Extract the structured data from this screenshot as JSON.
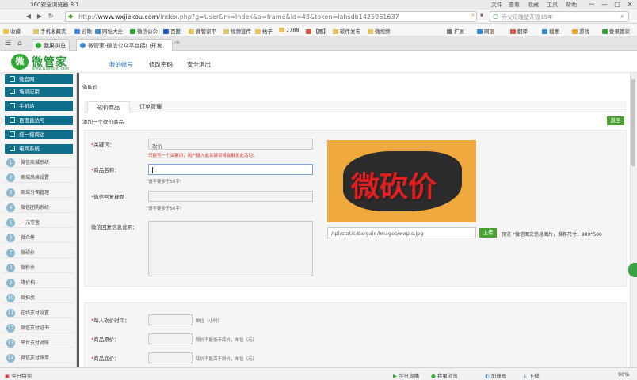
{
  "window": {
    "title": "360安全浏览器 8.1",
    "menus": [
      "文件",
      "查看",
      "收藏",
      "工具",
      "帮助"
    ],
    "controls": [
      "☰",
      "—",
      "□",
      "✕"
    ]
  },
  "address": {
    "url_scheme": "http://",
    "url_host": "www.wxjiekou.com",
    "url_path": "/index.php?g=User&m=Index&a=frame&id=48&token=lahsdb1425961637",
    "search_placeholder": "乔父母雕塑开毁15年"
  },
  "bookmarks": [
    "收藏",
    "手机收藏夹",
    "谷歌",
    "网址大全",
    "微信公众",
    "百度",
    "微管家平",
    "视频宣传",
    "帖子",
    "7788",
    "【图】",
    "软件发布",
    "微视频",
    "扩展",
    "网银",
    "翻译",
    "截图",
    "游戏",
    "登录管家"
  ],
  "tabs": [
    {
      "label": "我果浏览"
    },
    {
      "label": "微管家-微信公众平台接口开发"
    }
  ],
  "header": {
    "brand": "微管家",
    "brand_url": "www.wxjiekou.com",
    "nav": [
      "我的帐号",
      "修改密码",
      "安全退出"
    ]
  },
  "sidebar": {
    "groups": [
      {
        "label": "微官网"
      },
      {
        "label": "场景应用"
      },
      {
        "label": "手机站"
      },
      {
        "label": "百度直达号"
      },
      {
        "label": "摇一摇周边"
      },
      {
        "label": "电商系统"
      }
    ],
    "items": [
      {
        "num": "1",
        "label": "微信商城系统"
      },
      {
        "num": "2",
        "label": "商城风格设置"
      },
      {
        "num": "3",
        "label": "商城分佣管理"
      },
      {
        "num": "4",
        "label": "微信团购系统"
      },
      {
        "num": "5",
        "label": "一元夺宝"
      },
      {
        "num": "6",
        "label": "微众筹"
      },
      {
        "num": "7",
        "label": "微砍价"
      },
      {
        "num": "8",
        "label": "微秒杀"
      },
      {
        "num": "9",
        "label": "降价拍"
      },
      {
        "num": "10",
        "label": "微拍卖"
      },
      {
        "num": "11",
        "label": "在线支付设置"
      },
      {
        "num": "12",
        "label": "微信支付证书"
      },
      {
        "num": "13",
        "label": "平台支付对账"
      },
      {
        "num": "14",
        "label": "微信支付账单"
      }
    ]
  },
  "main": {
    "breadcrumb": "微砍价",
    "subtabs": [
      "砍价商品",
      "订单管理"
    ],
    "section_title": "添加一个砍价商品",
    "back_label": "返回",
    "form": {
      "keyword_label": "关键词：",
      "keyword_value": "砍价",
      "keyword_hint": "只能写一个关键词，用户输入此关键词将会触发此活动。",
      "name_label": "商品名称：",
      "name_value": "",
      "name_hint": "请不要多于50字!",
      "reply_title_label": "微信回复标题：",
      "reply_title_value": "",
      "reply_title_hint": "请不要多于50字!",
      "reply_desc_label": "微信回复信息说明：",
      "image_text": "微砍价",
      "image_path": "/tpl/static/bargain/images/wxpic.jpg",
      "upload_label": "上传",
      "preview_label": "预览",
      "image_note": "*微信图文信息图片，推荐尺寸：900*500",
      "time_label": "每人砍价时间：",
      "time_unit": "单位（小时）",
      "orig_price_label": "商品原价：",
      "orig_price_hint": "原价不能低于底价，单位（元）",
      "min_price_label": "商品底价：",
      "min_price_hint": "底价不能高于原价，单位（元）"
    }
  },
  "status": {
    "left": "今日特卖",
    "items": [
      "今日直播",
      "我果浏览",
      "加速器",
      "下载"
    ],
    "zoom": "90%"
  },
  "colors": {
    "accent": "#0f6e8a",
    "green": "#4aa12f",
    "required": "#dd3333",
    "image_bg": "#f0a93c"
  }
}
